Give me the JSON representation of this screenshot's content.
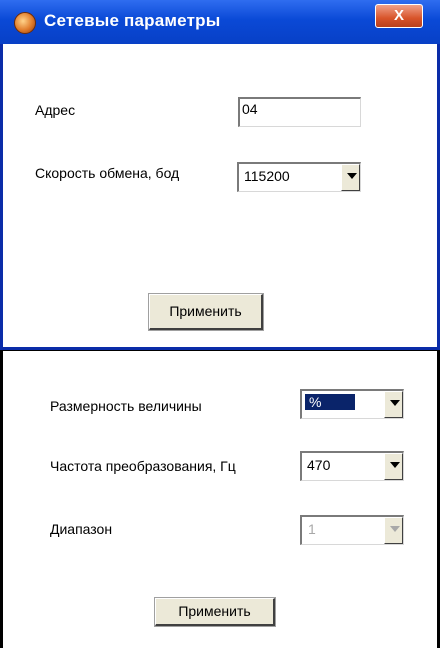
{
  "window": {
    "title": "Сетевые параметры",
    "close_label": "X"
  },
  "network": {
    "address_label": "Адрес",
    "address_value": "04",
    "baud_label": "Скорость обмена, бод",
    "baud_value": "115200",
    "apply_label": "Применить"
  },
  "measurement": {
    "unit_label": "Размерность величины",
    "unit_value": "%",
    "freq_label": "Частота преобразования, Гц",
    "freq_value": "470",
    "range_label": "Диапазон",
    "range_value": "1",
    "apply_label": "Применить"
  }
}
